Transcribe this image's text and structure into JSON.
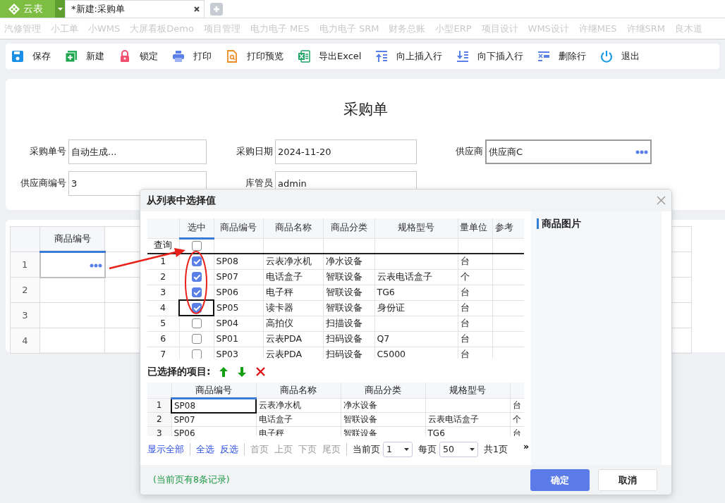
{
  "app": {
    "logo": "云表"
  },
  "tabs": [
    {
      "label": "*新建:采购单",
      "selected": true
    }
  ],
  "menu": [
    "汽修管理",
    "小工单",
    "小WMS",
    "大屏看板Demo",
    "项目管理",
    "电力电子 MES",
    "电力电子 SRM",
    "财务总账",
    "小型ERP",
    "项目设计",
    "WMS设计",
    "许继MES",
    "许继SRM",
    "良木道"
  ],
  "toolbar": [
    "保存",
    "新建",
    "锁定",
    "打印",
    "打印预览",
    "导出Excel",
    "向上插入行",
    "向下插入行",
    "删除行",
    "退出"
  ],
  "form": {
    "title": "采购单",
    "fields": [
      {
        "label": "采购单号",
        "value": "自动生成..."
      },
      {
        "label": "采购日期",
        "value": "2024-11-20"
      },
      {
        "label": "供应商",
        "value": "供应商C",
        "picker": true
      },
      {
        "label": "供应商编号",
        "value": "3"
      },
      {
        "label": "库管员",
        "value": "admin"
      }
    ]
  },
  "grid": {
    "columns": [
      "商品编号"
    ],
    "rows": [
      "1",
      "2",
      "3",
      "4"
    ]
  },
  "dialog": {
    "title": "从列表中选择值",
    "list": {
      "columns": [
        "选中",
        "商品编号",
        "商品名称",
        "商品分类",
        "规格型号",
        "量单位",
        "参考"
      ],
      "query_label": "查询",
      "query_checked": false,
      "rows": [
        {
          "num": "1",
          "checked": true,
          "code": "SP08",
          "name": "云表净水机",
          "category": "净水设备",
          "unit": "台"
        },
        {
          "num": "2",
          "checked": true,
          "code": "SP07",
          "name": "电话盒子",
          "category": "智联设备",
          "spec": "云表电话盒子",
          "unit": "个"
        },
        {
          "num": "3",
          "checked": true,
          "code": "SP06",
          "name": "电子秤",
          "category": "智联设备",
          "spec": "TG6",
          "unit": "台"
        },
        {
          "num": "4",
          "checked": true,
          "code": "SP05",
          "name": "读卡器",
          "category": "智联设备",
          "spec": "身份证",
          "unit": "台"
        },
        {
          "num": "5",
          "checked": false,
          "code": "SP04",
          "name": "高拍仪",
          "category": "扫描设备",
          "unit": "台"
        },
        {
          "num": "6",
          "checked": false,
          "code": "SP01",
          "name": "云表PDA",
          "category": "扫码设备",
          "spec": "Q7",
          "unit": "台"
        },
        {
          "num": "7",
          "checked": false,
          "code": "SP03",
          "name": "云表PDA",
          "category": "扫码设备",
          "spec": "C5000",
          "unit": "台"
        }
      ]
    },
    "selected_label": "已选择的项目:",
    "selected": {
      "columns": [
        "商品编号",
        "商品名称",
        "商品分类",
        "规格型号"
      ],
      "rows": [
        {
          "num": "1",
          "code": "SP08",
          "name": "云表净水机",
          "category": "净水设备",
          "column_5": "台"
        },
        {
          "num": "2",
          "code": "SP07",
          "name": "电话盒子",
          "category": "智联设备",
          "spec": "云表电话盒子",
          "column_5": "个"
        },
        {
          "num": "3",
          "code": "SP06",
          "name": "电子秤",
          "category": "智联设备",
          "spec": "TG6",
          "column_5": "台"
        }
      ]
    },
    "pager": {
      "groups": [
        [
          {
            "label": "显示全部",
            "disabled": false
          }
        ],
        [
          {
            "label": "全选",
            "disabled": false
          },
          {
            "label": "反选",
            "disabled": false
          }
        ],
        [
          {
            "label": "首页",
            "disabled": true
          },
          {
            "label": "上页",
            "disabled": true
          },
          {
            "label": "下页",
            "disabled": true
          },
          {
            "label": "尾页",
            "disabled": true
          }
        ]
      ],
      "current_page_label": "当前页",
      "current_page": "1",
      "per_page_label": "每页",
      "per_page": "50",
      "total": "共1页",
      "more": "»"
    },
    "image_title": "商品图片",
    "footer_note": "(当前页有8条记录)",
    "buttons": [
      {
        "label": "确定",
        "kind": "primary"
      },
      {
        "label": "取消",
        "kind": "secondary"
      }
    ]
  }
}
